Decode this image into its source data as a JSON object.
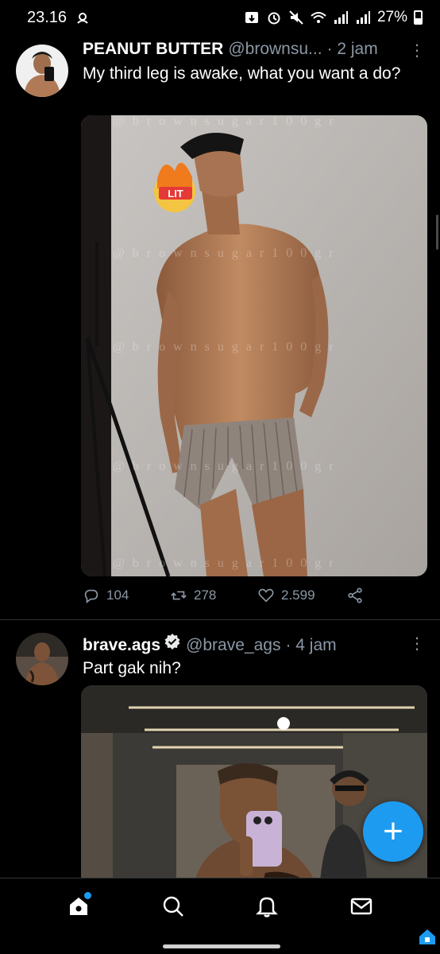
{
  "status_bar": {
    "time": "23.16",
    "battery": "27%"
  },
  "tweets": [
    {
      "name": "PEANUT BUTTER",
      "handle": "@brownsu...",
      "time": "· 2 jam",
      "more": "⋮",
      "text": "My third leg is awake, what you want a do?",
      "media_overlay": {
        "emoji_label": "LIT",
        "watermark": "@brownsugar100gr"
      },
      "replies": "104",
      "retweets": "278",
      "likes": "2.599"
    },
    {
      "name": "brave.ags",
      "verified": true,
      "handle": "@brave_ags",
      "time": "· 4 jam",
      "more": "⋮",
      "text": "Part gak nih?"
    }
  ],
  "fab": {
    "label": "+"
  },
  "bottom_nav": {
    "items": [
      "home-icon",
      "search-icon",
      "notifications-icon",
      "messages-icon"
    ]
  },
  "colors": {
    "background": "#000000",
    "accent": "#1d9bf0",
    "secondary_text": "#8b98a5",
    "divider": "#2f3336"
  }
}
